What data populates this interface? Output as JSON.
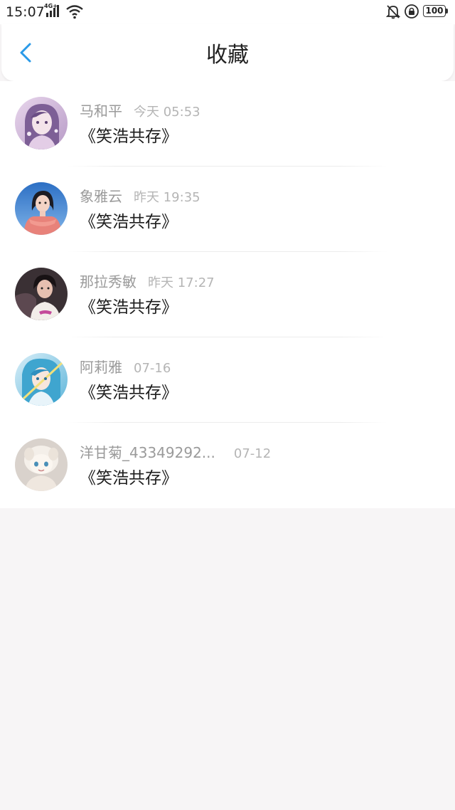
{
  "status_bar": {
    "time": "15:07",
    "network": "4G+",
    "battery": "100"
  },
  "header": {
    "title": "收藏",
    "back_icon": "chevron-left-icon",
    "accent_color": "#2a9ae8"
  },
  "favorites": [
    {
      "username": "马和平",
      "time": "今天 05:53",
      "content": "《笑浩共存》",
      "avatar": "avatar-anime-girl-purple"
    },
    {
      "username": "象雅云",
      "time": "昨天 19:35",
      "content": "《笑浩共存》",
      "avatar": "avatar-girl-pink-dress"
    },
    {
      "username": "那拉秀敏",
      "time": "昨天 17:27",
      "content": "《笑浩共存》",
      "avatar": "avatar-man-dark"
    },
    {
      "username": "阿莉雅",
      "time": "07-16",
      "content": "《笑浩共存》",
      "avatar": "avatar-anime-blue-hair"
    },
    {
      "username": "洋甘菊_43349292...",
      "time": "07-12",
      "content": "《笑浩共存》",
      "avatar": "avatar-plush-doll"
    }
  ]
}
